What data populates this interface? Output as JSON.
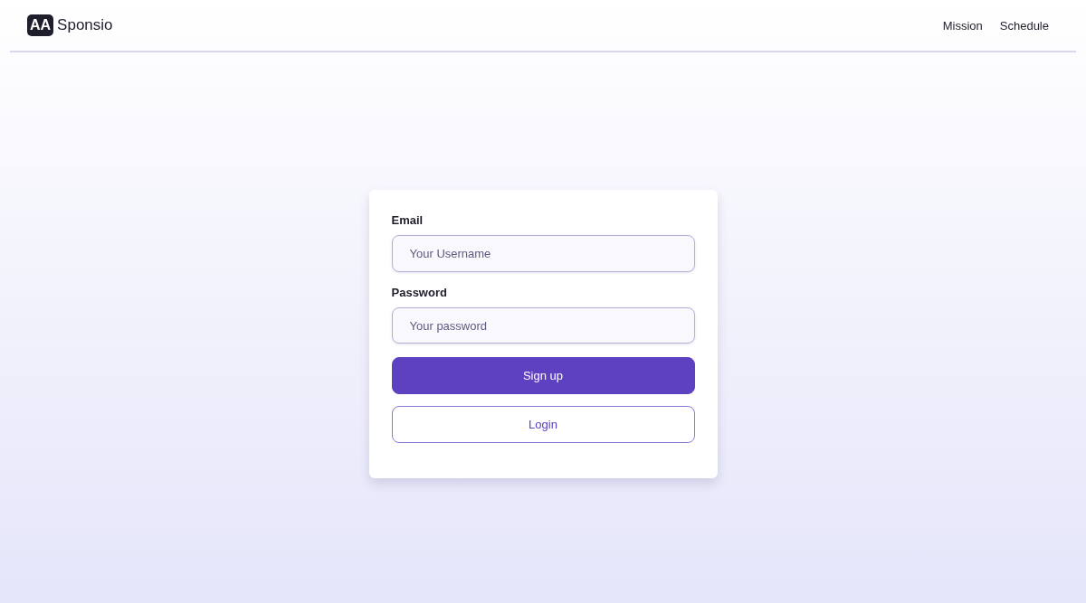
{
  "header": {
    "logo_mark": "AA",
    "brand": "Sponsio",
    "nav": [
      "Mission",
      "Schedule"
    ]
  },
  "form": {
    "fields": [
      {
        "label": "Email",
        "placeholder": "Your Username"
      },
      {
        "label": "Password",
        "placeholder": "Your password"
      }
    ],
    "buttons": [
      {
        "label": "Sign up",
        "kind": "primary"
      },
      {
        "label": "Login",
        "kind": "outline"
      }
    ]
  }
}
